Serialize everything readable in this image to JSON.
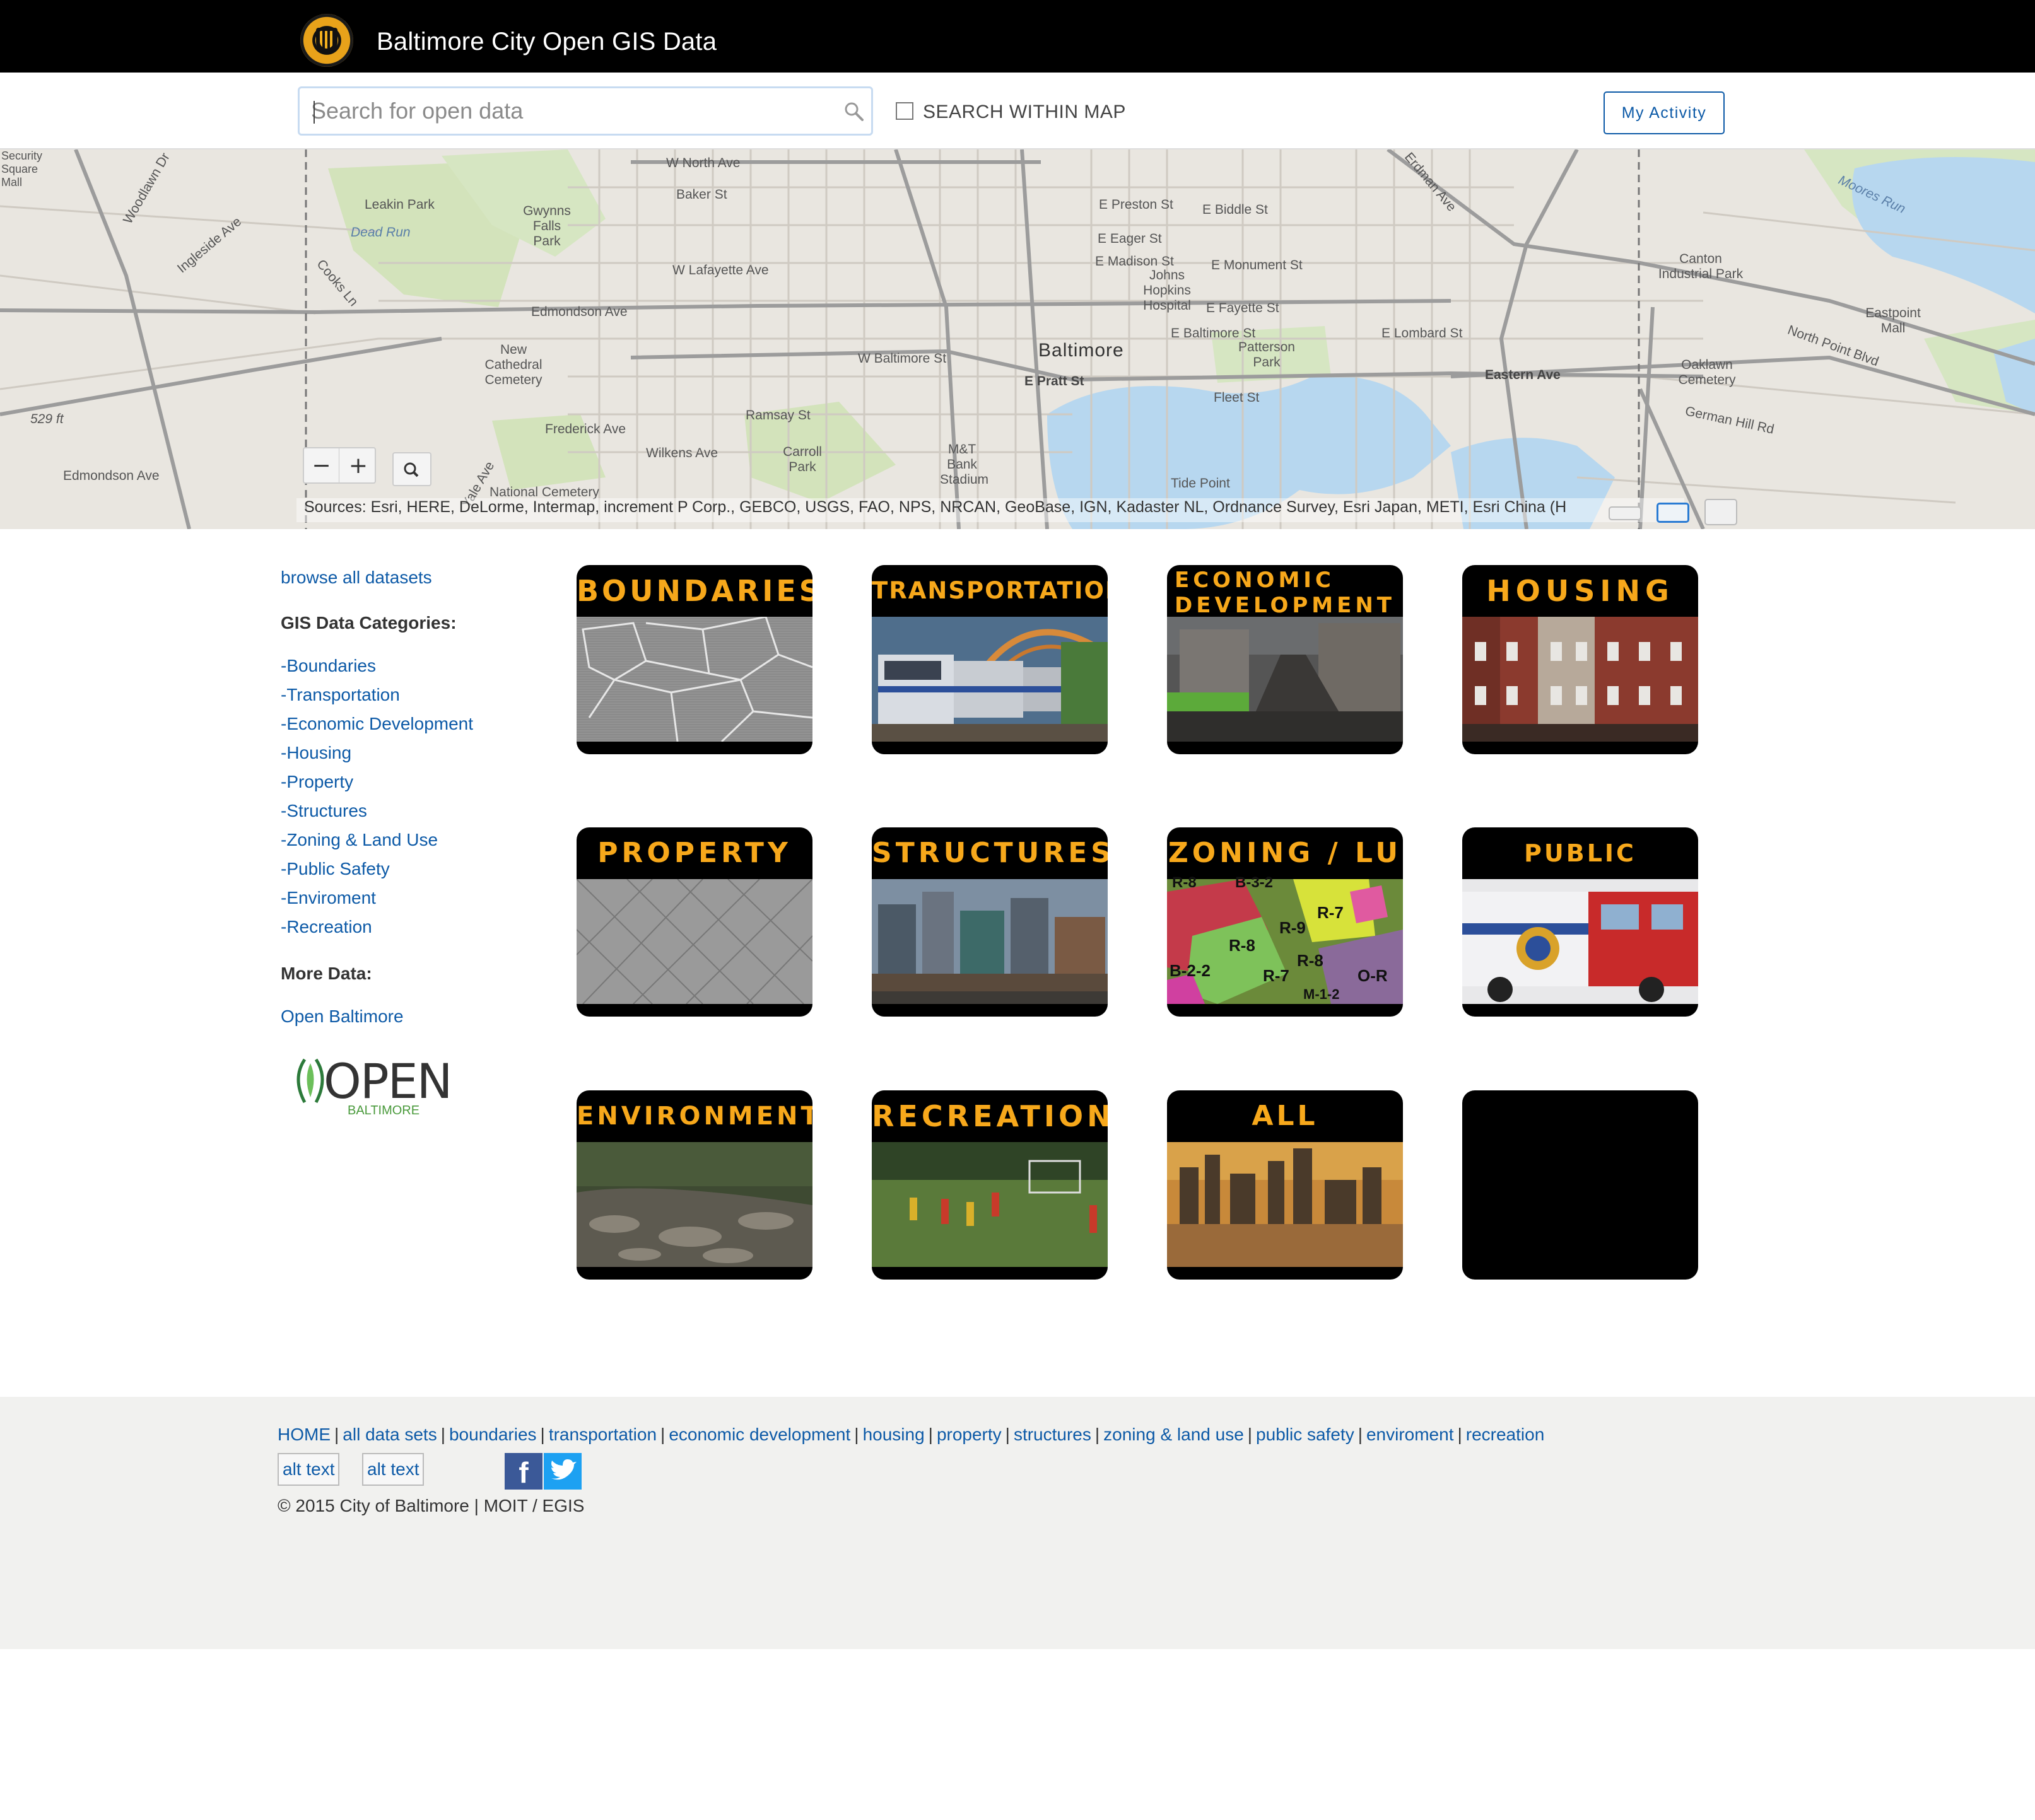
{
  "header": {
    "site_title": "Baltimore City Open GIS Data",
    "logo_icon": "city-seal-icon"
  },
  "search": {
    "placeholder": "Search for open data",
    "within_map_label": "SEARCH WITHIN MAP",
    "within_map_checked": false,
    "my_activity_label": "My Activity"
  },
  "map": {
    "city_label": "Baltimore",
    "labels": [
      "W North Ave",
      "Leakin Park",
      "Gwynns Falls Park",
      "Dead Run",
      "Edmondson Ave",
      "W Lafayette Ave",
      "W Baltimore St",
      "Baker St",
      "E Preston St",
      "E Biddle St",
      "E Eager St",
      "E Madison St",
      "E Monument St",
      "E Fayette St",
      "E Baltimore St",
      "E Lombard St",
      "E Pratt St",
      "Eastern Ave",
      "Fleet St",
      "Frederick Ave",
      "Ramsay St",
      "Wilkens Ave",
      "New Cathedral Cemetery",
      "Carroll Park",
      "Patterson Park",
      "Canton Industrial Park",
      "Eastpoint Mall",
      "Oaklawn Cemetery",
      "Johns Hopkins Hospital",
      "M&T Bank Stadium",
      "North Point Blvd",
      "Erdman Ave",
      "Edmondson Ave",
      "529 ft",
      "Security Square Mall",
      "Cooks Ln",
      "Ingleside Ave",
      "Woodlawn Dr",
      "Yale Ave",
      "National Cemetery",
      "Tide Point",
      "Moores Run",
      "German Hill Rd"
    ],
    "zoom_out_label": "−",
    "zoom_in_label": "+",
    "search_icon": "magnifier-icon",
    "attribution": "Sources: Esri, HERE, DeLorme, Intermap, increment P Corp., GEBCO, USGS, FAO, NPS, NRCAN, GeoBase, IGN, Kadaster NL, Ordnance Survey, Esri Japan, METI, Esri China (H"
  },
  "sidebar": {
    "browse_all": "browse all datasets",
    "categories_heading": "GIS Data Categories:",
    "categories": [
      "Boundaries",
      "Transportation",
      "Economic Development",
      "Housing",
      "Property",
      "Structures",
      "Zoning & Land Use",
      "Public Safety",
      "Enviroment",
      "Recreation"
    ],
    "dash": "-",
    "more_heading": "More Data:",
    "open_baltimore_link": "Open Baltimore",
    "open_logo_text": "OPEN",
    "open_logo_sub": "BALTIMORE"
  },
  "tiles": [
    {
      "title": "BOUNDARIES",
      "image": "gray-boundary-map"
    },
    {
      "title": "TRANSPORTATION",
      "image": "light-rail-train"
    },
    {
      "title": "ECONOMIC DEVELOPMENT",
      "image": "street-construction"
    },
    {
      "title": "HOUSING",
      "image": "brick-rowhouses"
    },
    {
      "title": "PROPERTY",
      "image": "parcel-map"
    },
    {
      "title": "STRUCTURES",
      "image": "harbor-skyline"
    },
    {
      "title": "ZONING / LU",
      "image": "zoning-map"
    },
    {
      "title": "PUBLIC SAFETY",
      "image": "fire-and-police-vehicles"
    },
    {
      "title": "ENVIRONMENT",
      "image": "rocky-stream"
    },
    {
      "title": "RECREATION",
      "image": "soccer-field"
    },
    {
      "title": "ALL DATASETS",
      "image": "city-skyline-sunset"
    },
    {
      "title": "",
      "image": "blank-black"
    }
  ],
  "zoning_labels": [
    "R-8",
    "B-3-2",
    "R-7",
    "R-9",
    "R-8",
    "R-8",
    "B-2-2",
    "R-7",
    "O-R",
    "M-1-2"
  ],
  "footer": {
    "links": [
      "HOME",
      "all data sets",
      "boundaries",
      "transportation",
      "economic development",
      "housing",
      "property",
      "structures",
      "zoning & land use",
      "public safety",
      "enviroment",
      "recreation"
    ],
    "separator": "|",
    "alt_text_1": "alt text",
    "alt_text_2": "alt text",
    "facebook_icon": "facebook-icon",
    "facebook_glyph": "f",
    "twitter_icon": "twitter-icon",
    "copyright": "© 2015 City of Baltimore | MOIT / EGIS"
  },
  "colors": {
    "header_bg": "#000000",
    "link": "#0d5aa7",
    "tile_title": "#f7a81b",
    "footer_bg": "#f1f1ef",
    "water": "#b7d7ef",
    "park": "#cfe0b7"
  }
}
